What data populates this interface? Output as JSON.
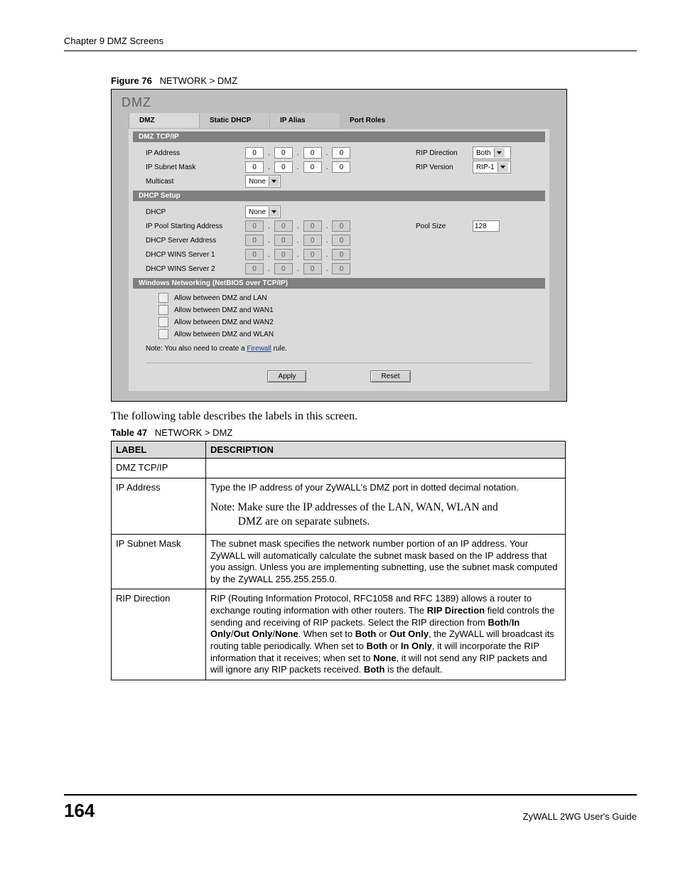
{
  "chapter": "Chapter 9 DMZ Screens",
  "figure_caption_label": "Figure 76",
  "figure_caption_text": "NETWORK > DMZ",
  "ui": {
    "title": "DMZ",
    "tabs": [
      "DMZ",
      "Static DHCP",
      "IP Alias",
      "Port Roles"
    ],
    "sections": {
      "tcp_ip": {
        "header": "DMZ TCP/IP",
        "ip_address_label": "IP Address",
        "ip_address": [
          "0",
          "0",
          "0",
          "0"
        ],
        "subnet_label": "IP Subnet Mask",
        "subnet": [
          "0",
          "0",
          "0",
          "0"
        ],
        "multicast_label": "Multicast",
        "multicast_value": "None",
        "rip_dir_label": "RIP Direction",
        "rip_dir_value": "Both",
        "rip_ver_label": "RIP Version",
        "rip_ver_value": "RIP-1"
      },
      "dhcp": {
        "header": "DHCP Setup",
        "dhcp_label": "DHCP",
        "dhcp_value": "None",
        "pool_start_label": "IP Pool Starting Address",
        "pool_start": [
          "0",
          "0",
          "0",
          "0"
        ],
        "server_label": "DHCP Server Address",
        "server": [
          "0",
          "0",
          "0",
          "0"
        ],
        "wins1_label": "DHCP WINS Server 1",
        "wins1": [
          "0",
          "0",
          "0",
          "0"
        ],
        "wins2_label": "DHCP WINS Server 2",
        "wins2": [
          "0",
          "0",
          "0",
          "0"
        ],
        "pool_size_label": "Pool Size",
        "pool_size_value": "128"
      },
      "netbios": {
        "header": "Windows Networking (NetBIOS over TCP/IP)",
        "opts": [
          "Allow between DMZ and LAN",
          "Allow between DMZ and WAN1",
          "Allow between DMZ and WAN2",
          "Allow between DMZ and WLAN"
        ],
        "note_prefix": "Note: You also need to create a ",
        "note_link": "Firewall",
        "note_suffix": " rule."
      }
    },
    "apply_label": "Apply",
    "reset_label": "Reset"
  },
  "following_text": "The following table describes the labels in this screen.",
  "table_caption_label": "Table 47",
  "table_caption_text": "NETWORK > DMZ",
  "table": {
    "headers": [
      "LABEL",
      "DESCRIPTION"
    ],
    "rows": [
      {
        "label": "DMZ TCP/IP",
        "desc": ""
      },
      {
        "label": "IP Address",
        "desc": "Type the IP address of your ZyWALL's DMZ port in dotted decimal notation.",
        "note": "Note: Make sure the IP addresses of the LAN, WAN, WLAN and DMZ are on separate subnets."
      },
      {
        "label": "IP Subnet Mask",
        "desc": "The subnet mask specifies the network number portion of an IP address. Your ZyWALL will automatically calculate the subnet mask based on the IP address that you assign. Unless you are implementing subnetting, use the subnet mask computed by the ZyWALL 255.255.255.0."
      },
      {
        "label": "RIP Direction",
        "desc_html": "RIP (Routing Information Protocol, RFC1058 and RFC 1389) allows a router to exchange routing information with other routers. The <b>RIP Direction</b> field controls the sending and receiving of RIP packets. Select the RIP direction from <b>Both</b>/<b>In Only</b>/<b>Out Only</b>/<b>None</b>. When set to <b>Both</b> or <b>Out Only</b>, the ZyWALL will broadcast its routing table periodically. When set to <b>Both</b> or <b>In Only</b>, it will incorporate the RIP information that it receives; when set to <b>None</b>, it will not send any RIP packets and will ignore any RIP packets received. <b>Both</b> is the default."
      }
    ]
  },
  "page_number": "164",
  "guide_name": "ZyWALL 2WG User's Guide"
}
